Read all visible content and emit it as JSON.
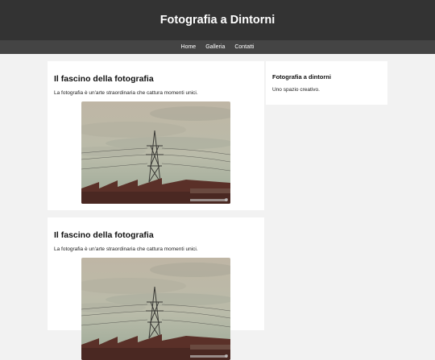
{
  "header": {
    "title": "Fotografia a Dintorni"
  },
  "nav": {
    "items": [
      "Home",
      "Galleria",
      "Contatti"
    ]
  },
  "posts": [
    {
      "title": "Il fascino della fotografia",
      "text": "La fotografia è un'arte straordinaria che cattura momenti unici.",
      "image_alt": "Traliccio elettrico al tramonto"
    },
    {
      "title": "Il fascino della fotografia",
      "text": "La fotografia è un'arte straordinaria che cattura momenti unici.",
      "image_alt": "Traliccio elettrico al tramonto"
    }
  ],
  "sidebar": {
    "title": "Fotografia a dintorni",
    "text": "Uno spazio creativo."
  },
  "colors": {
    "header_bg": "#333333",
    "nav_bg": "#444444",
    "page_bg": "#f2f2f2",
    "card_bg": "#ffffff"
  }
}
